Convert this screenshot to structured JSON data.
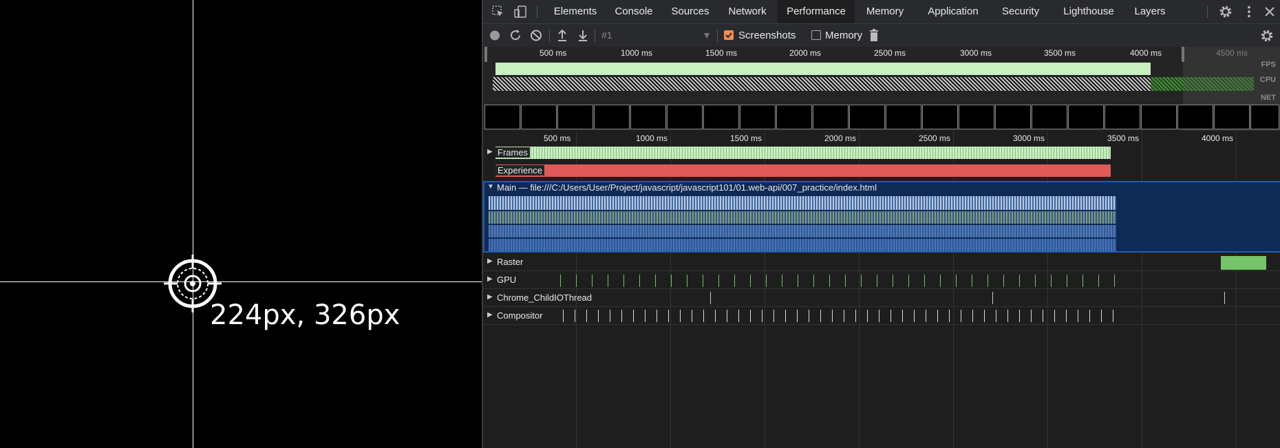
{
  "viewport": {
    "coordinate_text": "224px, 326px"
  },
  "devtools": {
    "tabs": [
      {
        "label": "Elements"
      },
      {
        "label": "Console"
      },
      {
        "label": "Sources"
      },
      {
        "label": "Network"
      },
      {
        "label": "Performance"
      },
      {
        "label": "Memory"
      },
      {
        "label": "Application"
      },
      {
        "label": "Security"
      },
      {
        "label": "Lighthouse"
      },
      {
        "label": "Layers"
      }
    ],
    "toolbar": {
      "profile_select": "#1",
      "screenshots_label": "Screenshots",
      "screenshots_checked": true,
      "memory_label": "Memory",
      "memory_checked": false
    },
    "overview": {
      "ticks": [
        "500 ms",
        "1000 ms",
        "1500 ms",
        "2000 ms",
        "2500 ms",
        "3000 ms",
        "3500 ms",
        "4000 ms",
        "4500 ms"
      ],
      "fps_label": "FPS",
      "cpu_label": "CPU",
      "net_label": "NET"
    },
    "timeline": {
      "ticks": [
        "500 ms",
        "1000 ms",
        "1500 ms",
        "2000 ms",
        "2500 ms",
        "3000 ms",
        "3500 ms",
        "4000 ms"
      ],
      "tracks": {
        "frames": "Frames",
        "experience": "Experience",
        "main": "Main — file:///C:/Users/User/Project/javascript/javascript101/01.web-api/007_practice/index.html",
        "raster": "Raster",
        "gpu": "GPU",
        "io": "Chrome_ChildIOThread",
        "compositor": "Compositor"
      }
    },
    "colors": {
      "accent": "#f28b54",
      "frames_green": "#c8f0c0",
      "experience_red": "#e05a5a",
      "main_blue": "#2a5a9a",
      "raster_green": "#75c46a"
    }
  }
}
